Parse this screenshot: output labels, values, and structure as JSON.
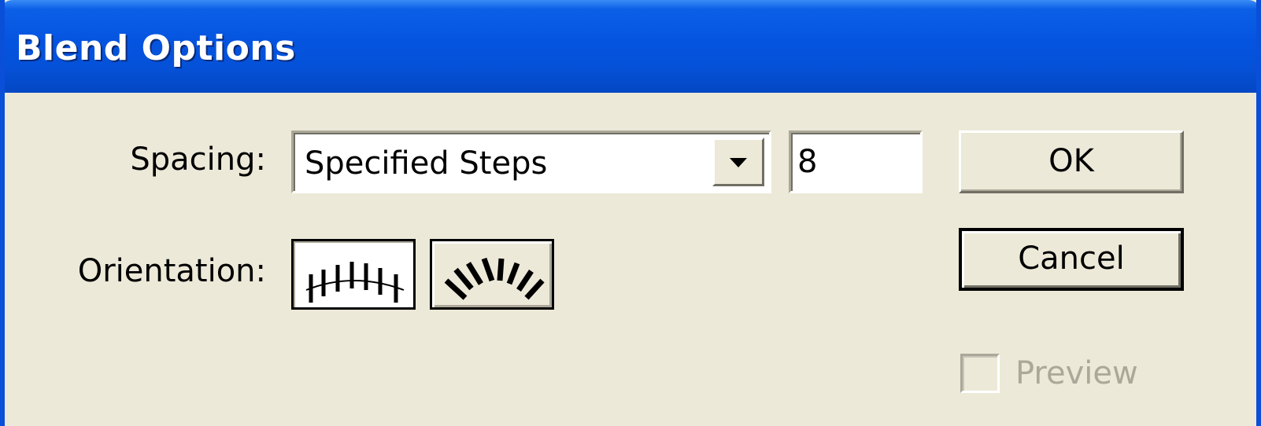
{
  "window": {
    "title": "Blend Options"
  },
  "spacing": {
    "label": "Spacing:",
    "selected": "Specified Steps",
    "steps_value": "8"
  },
  "orientation": {
    "label": "Orientation:",
    "options": [
      {
        "name": "Align to Page",
        "icon": "align-to-page-icon",
        "selected": true
      },
      {
        "name": "Align to Path",
        "icon": "align-to-path-icon",
        "selected": false
      }
    ]
  },
  "buttons": {
    "ok": "OK",
    "cancel": "Cancel"
  },
  "preview": {
    "label": "Preview",
    "checked": false,
    "enabled": false
  },
  "colors": {
    "titlebar": "#0554e0",
    "dialog_bg": "#ece9d8",
    "disabled_text": "#aca899"
  }
}
